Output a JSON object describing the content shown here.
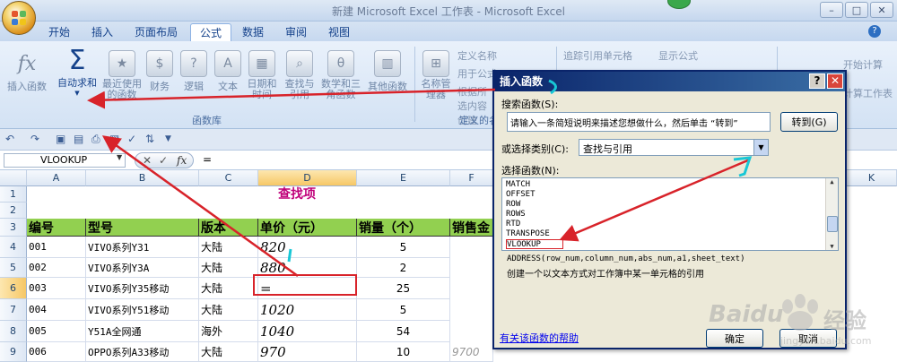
{
  "window": {
    "title": "新建 Microsoft Excel 工作表 - Microsoft Excel",
    "controls": [
      "–",
      "□",
      "✕"
    ]
  },
  "tabs": [
    "开始",
    "插入",
    "页面布局",
    "公式",
    "数据",
    "审阅",
    "视图"
  ],
  "active_tab": "公式",
  "ribbon": {
    "function_library": {
      "insert_function": "插入函数",
      "autosum": "自动求和",
      "recent": "最近使用的函数",
      "financial": "财务",
      "logical": "逻辑",
      "text": "文本",
      "datetime": "日期和时间",
      "lookup": "查找与引用",
      "math": "数学和三角函数",
      "other": "其他函数",
      "group_label": "函数库"
    },
    "defined_names": {
      "name_manager": "名称管理器",
      "define_name": "定义名称",
      "use_in_formula": "用于公式",
      "create_from_selection": "根据所选内容创建",
      "group_label": "定义的名称"
    },
    "formula_auditing": {
      "trace_precedents": "追踪引用单元格",
      "show_formulas": "显示公式"
    },
    "calculation": {
      "calc_now": "开始计算",
      "calc_sheet": "计算工作表"
    }
  },
  "formula_bar": {
    "name_box": "VLOOKUP",
    "content": "="
  },
  "sheet": {
    "columns": [
      "A",
      "B",
      "C",
      "D",
      "E",
      "F",
      "K"
    ],
    "selected_column": "D",
    "rows": [
      "1",
      "2",
      "3",
      "4",
      "5",
      "6",
      "7",
      "8",
      "9"
    ],
    "selected_row": "6",
    "title": "查找项",
    "headers": [
      "编号",
      "型号",
      "版本",
      "单价（元）",
      "销量（个）",
      "销售金"
    ],
    "data": [
      [
        "001",
        "VIVO系列Y31",
        "大陆",
        "820",
        "5"
      ],
      [
        "002",
        "VIVO系列Y3A",
        "大陆",
        "880",
        "2"
      ],
      [
        "003",
        "VIVO系列Y35移动",
        "大陆",
        "=",
        "25"
      ],
      [
        "004",
        "VIVO系列Y51移动",
        "大陆",
        "1020",
        "5"
      ],
      [
        "005",
        "Y51A全网通",
        "海外",
        "1040",
        "54"
      ],
      [
        "006",
        "OPPO系列A33移动",
        "大陆",
        "970",
        "10"
      ]
    ],
    "partial_f9": "9700"
  },
  "dialog": {
    "title": "插入函数",
    "search_label": "搜索函数(S):",
    "search_value": "请输入一条简短说明来描述您想做什么，然后单击 “转到”",
    "go_button": "转到(G)",
    "category_label": "或选择类别(C):",
    "category_value": "查找与引用",
    "list_label": "选择函数(N):",
    "functions": [
      "MATCH",
      "OFFSET",
      "ROW",
      "ROWS",
      "RTD",
      "TRANSPOSE",
      "VLOOKUP"
    ],
    "selected_function": "VLOOKUP",
    "signature": "ADDRESS(row_num,column_num,abs_num,a1,sheet_text)",
    "description": "创建一个以文本方式对工作簿中某一单元格的引用",
    "help_link": "有关该函数的帮助",
    "ok": "确定",
    "cancel": "取消"
  },
  "watermark": {
    "brand": "Baidu",
    "suffix": "经验",
    "url": "jingyan.baidu.com"
  },
  "colors": {
    "header_fill": "#92d050",
    "title_text": "#c0007a",
    "annotation_red": "#d8232a",
    "annotation_cyan": "#18c7d6"
  }
}
